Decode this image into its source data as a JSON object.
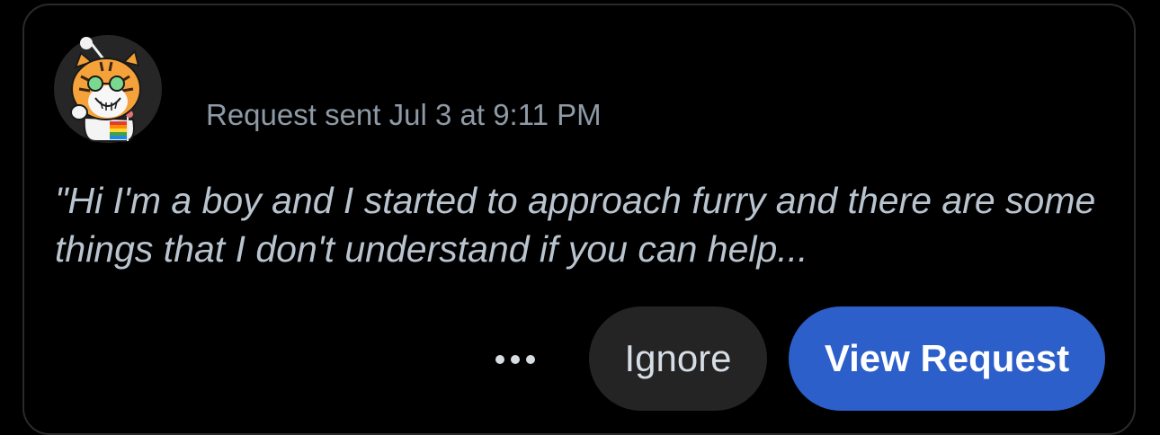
{
  "request": {
    "username": "",
    "timestamp": "Request sent Jul 3 at 9:11 PM",
    "message": "\"Hi I'm a boy and I started to approach furry and there are some things that I don't understand if you can help...",
    "avatar_icon": "reddit-snoo-tiger-avatar"
  },
  "actions": {
    "more_icon": "ellipsis-icon",
    "ignore_label": "Ignore",
    "view_label": "View Request"
  },
  "colors": {
    "background": "#000000",
    "card_border": "#2a2a2c",
    "timestamp": "#8e9aa6",
    "message": "#b9c4cf",
    "ignore_bg": "#242424",
    "view_bg": "#2c5fc9"
  }
}
